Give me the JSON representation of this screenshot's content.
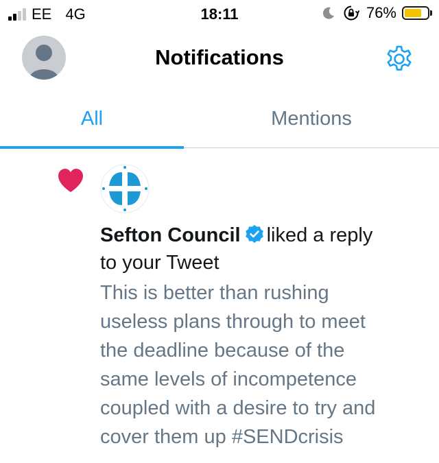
{
  "status_bar": {
    "carrier": "EE",
    "network": "4G",
    "time": "18:11",
    "battery_percent_label": "76%",
    "battery_level": 0.76,
    "signal_bars_filled": 2,
    "signal_bars_total": 4,
    "icons": [
      "moon-icon",
      "orientation-lock-icon"
    ]
  },
  "header": {
    "title": "Notifications",
    "avatar_icon": "default-user-avatar-icon",
    "settings_icon": "gear-icon"
  },
  "tabs": [
    {
      "label": "All",
      "selected": true
    },
    {
      "label": "Mentions",
      "selected": false
    }
  ],
  "notification": {
    "type_icon": "heart-icon",
    "sender_name": "Sefton Council",
    "verified": true,
    "action_part1": "liked a reply",
    "action_part2": "to your Tweet",
    "tweet_text": "This is better than rushing\nuseless plans through to meet\nthe deadline because of the\nsame levels of incompetence\ncoupled with a desire to try and\ncover them up #SENDcrisis"
  },
  "colors": {
    "accent": "#1da1f2",
    "like": "#e0245e",
    "secondary_text": "#657786",
    "battery": "#f5c400"
  }
}
